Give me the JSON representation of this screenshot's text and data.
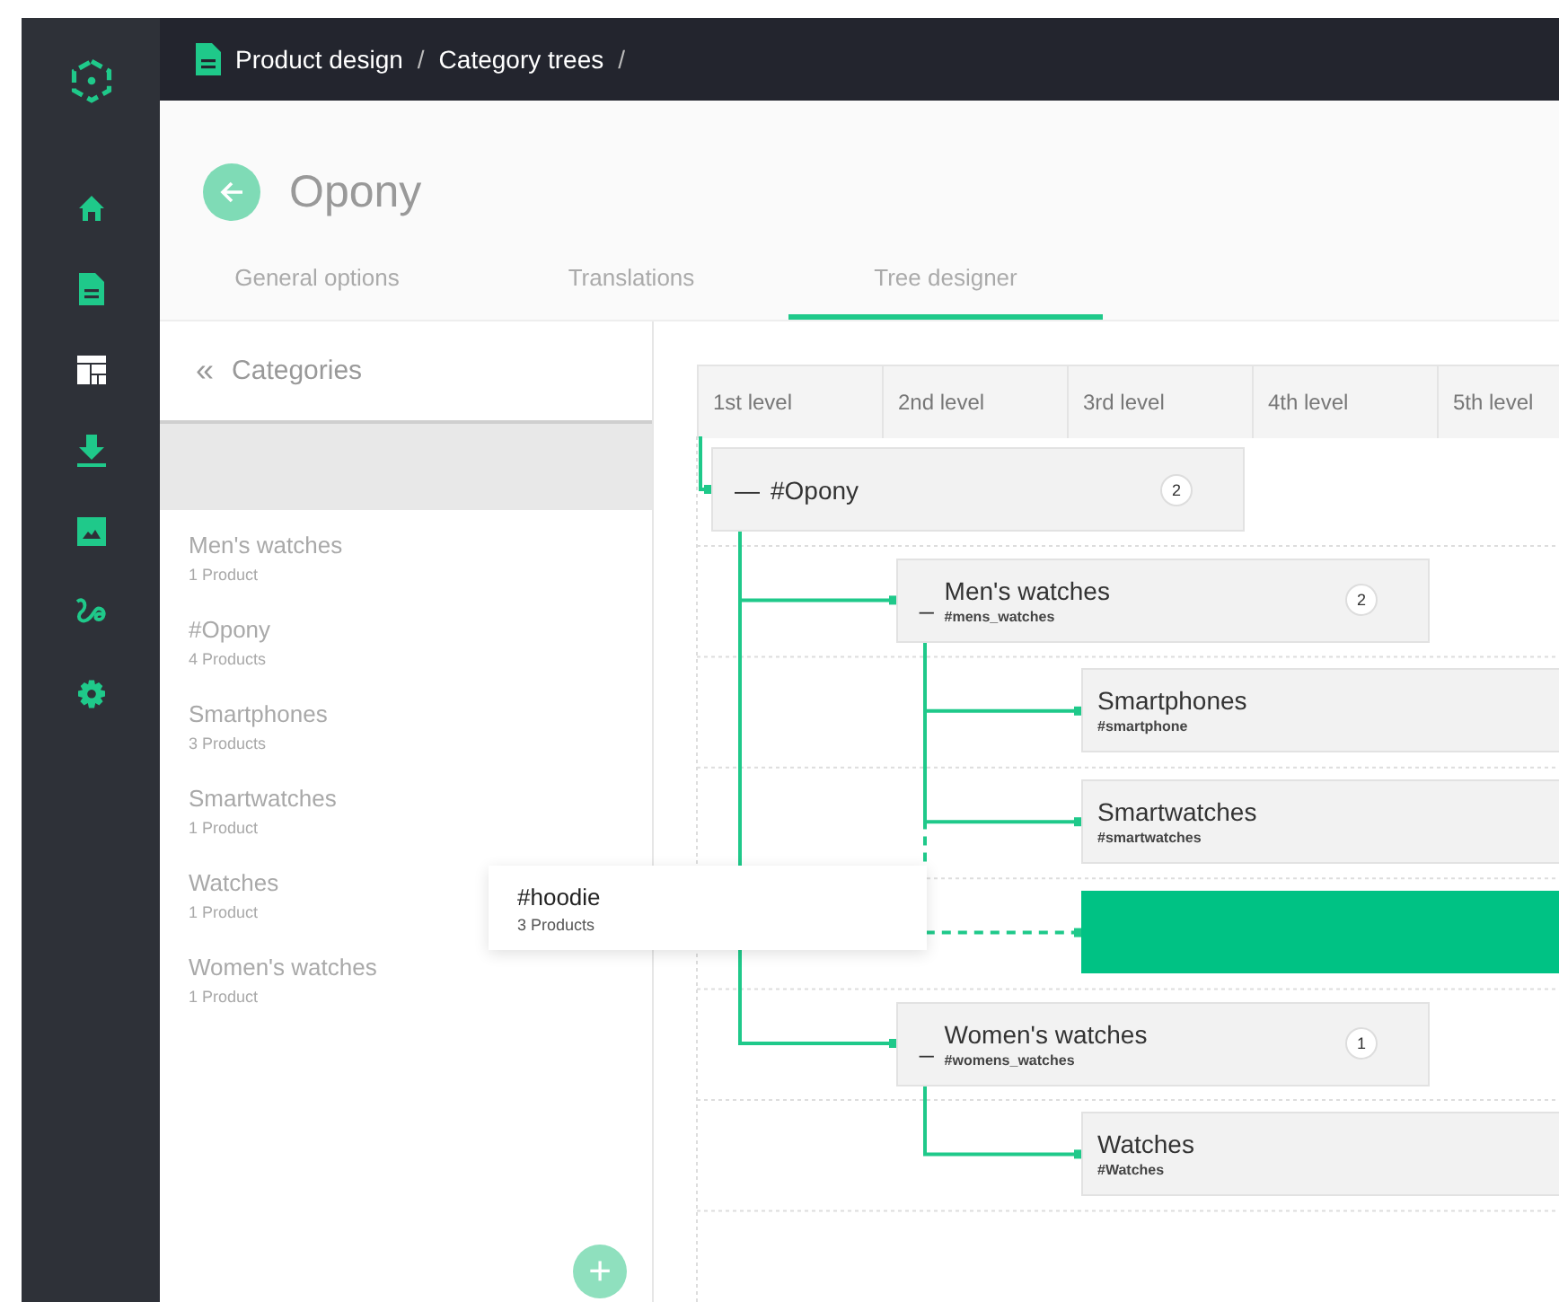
{
  "sidebar": {
    "items": [
      {
        "kind": "home"
      },
      {
        "kind": "document"
      },
      {
        "kind": "dashboard"
      },
      {
        "kind": "download"
      },
      {
        "kind": "image"
      },
      {
        "kind": "route"
      },
      {
        "kind": "settings"
      }
    ]
  },
  "breadcrumb": {
    "items": [
      "Product design",
      "Category trees"
    ],
    "separator": "/"
  },
  "page": {
    "title": "Opony"
  },
  "tabs": [
    {
      "label": "General options",
      "selected": false
    },
    {
      "label": "Translations",
      "selected": false
    },
    {
      "label": "Tree designer",
      "selected": true
    }
  ],
  "categories_panel": {
    "title": "Categories",
    "collapse": "«",
    "items": [
      {
        "name": "Men's watches",
        "count": "1 Product"
      },
      {
        "name": "#Opony",
        "count": "4 Products"
      },
      {
        "name": "Smartphones",
        "count": "3 Products"
      },
      {
        "name": "Smartwatches",
        "count": "1 Product"
      },
      {
        "name": "Watches",
        "count": "1 Product"
      },
      {
        "name": "Women's watches",
        "count": "1 Product"
      }
    ],
    "add_button": "+"
  },
  "levels": [
    "1st level",
    "2nd level",
    "3rd level",
    "4th level",
    "5th level"
  ],
  "tree": [
    {
      "kind": "node",
      "toggle": "—",
      "title": "#Opony",
      "count": "2",
      "children": [
        {
          "kind": "node",
          "toggle": "_",
          "title": "Men's watches",
          "tag": "#mens_watches",
          "count": "2",
          "children": [
            {
              "kind": "node",
              "title": "Smartphones",
              "tag": "#smartphone"
            },
            {
              "kind": "node",
              "title": "Smartwatches",
              "tag": "#smartwatches"
            },
            {
              "kind": "drop-target"
            }
          ]
        },
        {
          "kind": "node",
          "toggle": "_",
          "title": "Women's watches",
          "tag": "#womens_watches",
          "count": "1",
          "children": [
            {
              "kind": "node",
              "title": "Watches",
              "tag": "#Watches"
            }
          ]
        }
      ]
    }
  ],
  "dragged_item": {
    "title": "#hoodie",
    "subtitle": "3 Products"
  }
}
